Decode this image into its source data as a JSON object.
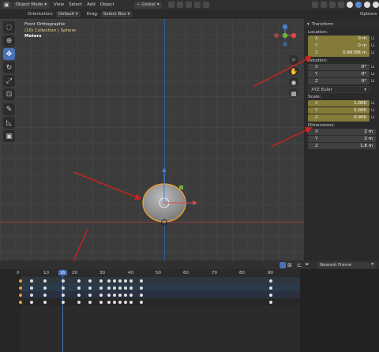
{
  "header": {
    "mode_label": "Object Mode",
    "menus": [
      "View",
      "Select",
      "Add",
      "Object"
    ],
    "transform_orientation": "Global",
    "options_label": "Options"
  },
  "tool_settings": {
    "orientation_label": "Orientation:",
    "orientation_value": "Default",
    "drag_label": "Drag:",
    "drag_value": "Select Box"
  },
  "viewport": {
    "view_name": "Front Orthographic",
    "collection_info": "(16) Collection | Sphere",
    "units": "Meters"
  },
  "npanel": {
    "title": "Transform",
    "location_label": "Location:",
    "location": [
      {
        "axis": "X",
        "value": "0 m"
      },
      {
        "axis": "Y",
        "value": "0 m"
      },
      {
        "axis": "Z",
        "value": "0.86788 m"
      }
    ],
    "rotation_label": "Rotation:",
    "rotation": [
      {
        "axis": "X",
        "value": "0°"
      },
      {
        "axis": "Y",
        "value": "0°"
      },
      {
        "axis": "Z",
        "value": "0°"
      }
    ],
    "rotation_mode": "XYZ Euler",
    "scale_label": "Scale:",
    "scale": [
      {
        "axis": "X",
        "value": "1.000"
      },
      {
        "axis": "Y",
        "value": "1.000"
      },
      {
        "axis": "Z",
        "value": "0.900"
      }
    ],
    "dimensions_label": "Dimensions:",
    "dimensions": [
      {
        "axis": "X",
        "value": "2 m"
      },
      {
        "axis": "Y",
        "value": "2 m"
      },
      {
        "axis": "Z",
        "value": "1.8 m"
      }
    ]
  },
  "timeline": {
    "current_frame": "16",
    "interpolation": "Nearest Frame",
    "ruler": [
      "0",
      "10",
      "20",
      "30",
      "40",
      "50",
      "60",
      "70",
      "80",
      "90"
    ]
  },
  "colors": {
    "accent_blue": "#4772b3",
    "gold_field": "#847b3a",
    "annotation_arrow": "#d42020",
    "selection_orange": "#f0a030"
  }
}
